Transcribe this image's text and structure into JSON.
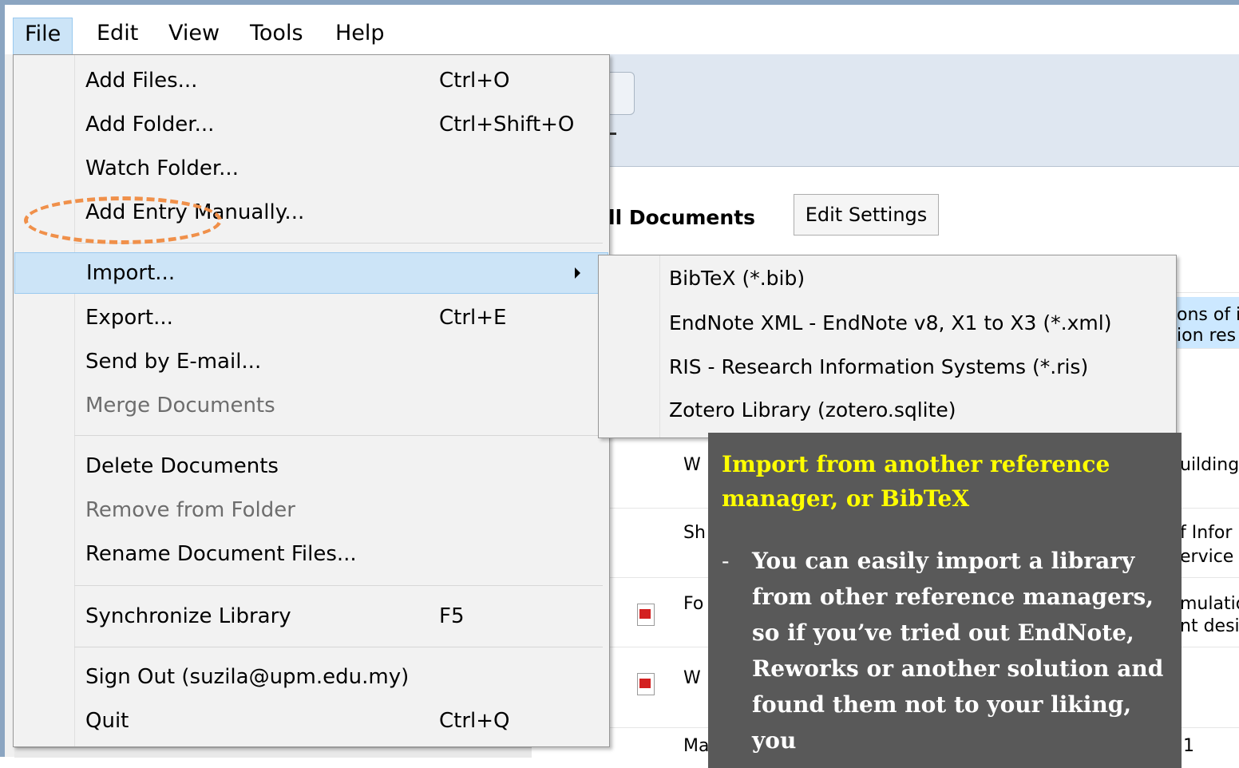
{
  "menubar": {
    "items": [
      "File",
      "Edit",
      "View",
      "Tools",
      "Help"
    ]
  },
  "file_menu": {
    "add_files": {
      "label": "Add Files...",
      "shortcut": "Ctrl+O"
    },
    "add_folder": {
      "label": "Add Folder...",
      "shortcut": "Ctrl+Shift+O"
    },
    "watch_folder": {
      "label": "Watch Folder..."
    },
    "add_entry": {
      "label": "Add Entry Manually..."
    },
    "import": {
      "label": "Import..."
    },
    "export": {
      "label": "Export...",
      "shortcut": "Ctrl+E"
    },
    "send_email": {
      "label": "Send by E-mail..."
    },
    "merge": {
      "label": "Merge Documents"
    },
    "delete": {
      "label": "Delete Documents"
    },
    "remove_folder": {
      "label": "Remove from Folder"
    },
    "rename_files": {
      "label": "Rename Document Files..."
    },
    "sync": {
      "label": "Synchronize Library",
      "shortcut": "F5"
    },
    "sign_out": {
      "label": "Sign Out (suzila@upm.edu.my)"
    },
    "quit": {
      "label": "Quit",
      "shortcut": "Ctrl+Q"
    }
  },
  "import_submenu": [
    "BibTeX (*.bib)",
    "EndNote XML - EndNote v8, X1 to X3 (*.xml)",
    "RIS - Research Information Systems (*.ris)",
    "Zotero Library (zotero.sqlite)"
  ],
  "background": {
    "header": "ll Documents",
    "edit_settings": "Edit Settings",
    "row1_a": "ons of i",
    "row1_b": "ion res",
    "row2_a": "W",
    "row2_b": "uilding",
    "row3_a": "Sh",
    "row3_b": "f Infor",
    "row3_c": "ervice",
    "row4_a": "Fo",
    "row4_b": "mulatio",
    "row4_c": "nt desi",
    "row5_a": "W",
    "row6_a": "Ma",
    "row6_b": "1"
  },
  "callout": {
    "title": "Import from another reference manager, or BibTeX",
    "bullet": "-",
    "body": "You can easily import a library from other reference managers, so if you’ve tried out EndNote, Reworks or another solution and found them not to your liking, you"
  },
  "colors": {
    "highlight": "#cce4f7",
    "callout_bg": "#595959",
    "callout_title": "#ffff00",
    "annotation_oval": "#f0904a",
    "window_border": "#8ba5c1"
  }
}
